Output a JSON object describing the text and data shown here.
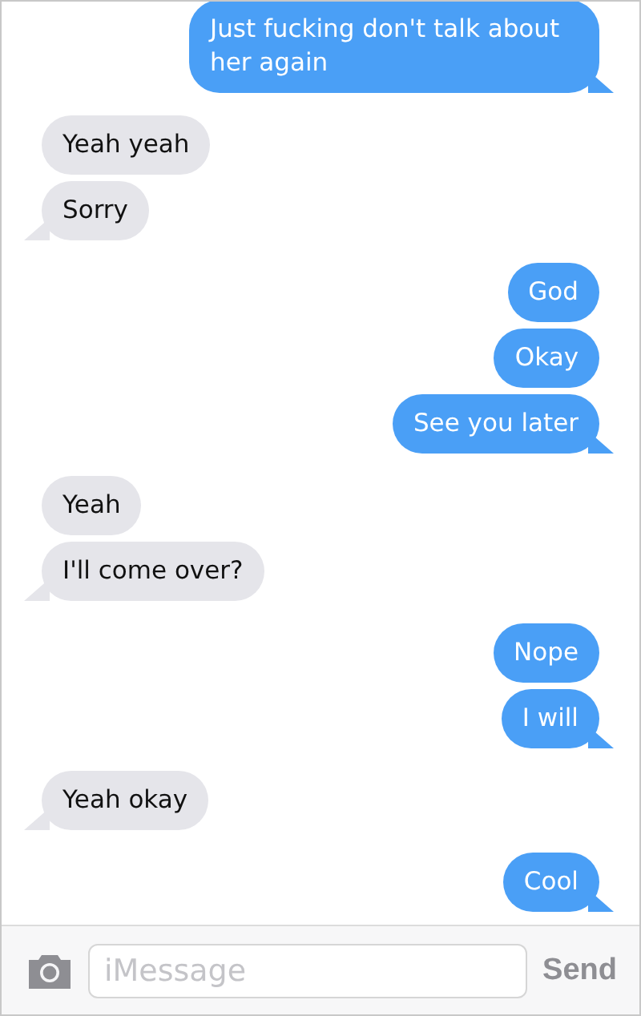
{
  "messages": [
    {
      "text": "Just fucking don't talk about her again",
      "sent": true,
      "tail": true
    },
    {
      "text": "Yeah yeah",
      "sent": false,
      "tail": false
    },
    {
      "text": "Sorry",
      "sent": false,
      "tail": true
    },
    {
      "text": "God",
      "sent": true,
      "tail": false
    },
    {
      "text": "Okay",
      "sent": true,
      "tail": false
    },
    {
      "text": "See you later",
      "sent": true,
      "tail": true
    },
    {
      "text": "Yeah",
      "sent": false,
      "tail": false
    },
    {
      "text": "I'll come over?",
      "sent": false,
      "tail": true
    },
    {
      "text": "Nope",
      "sent": true,
      "tail": false
    },
    {
      "text": "I will",
      "sent": true,
      "tail": true
    },
    {
      "text": "Yeah okay",
      "sent": false,
      "tail": true
    },
    {
      "text": "Cool",
      "sent": true,
      "tail": true
    }
  ],
  "composer": {
    "placeholder": "iMessage",
    "send": "Send"
  }
}
